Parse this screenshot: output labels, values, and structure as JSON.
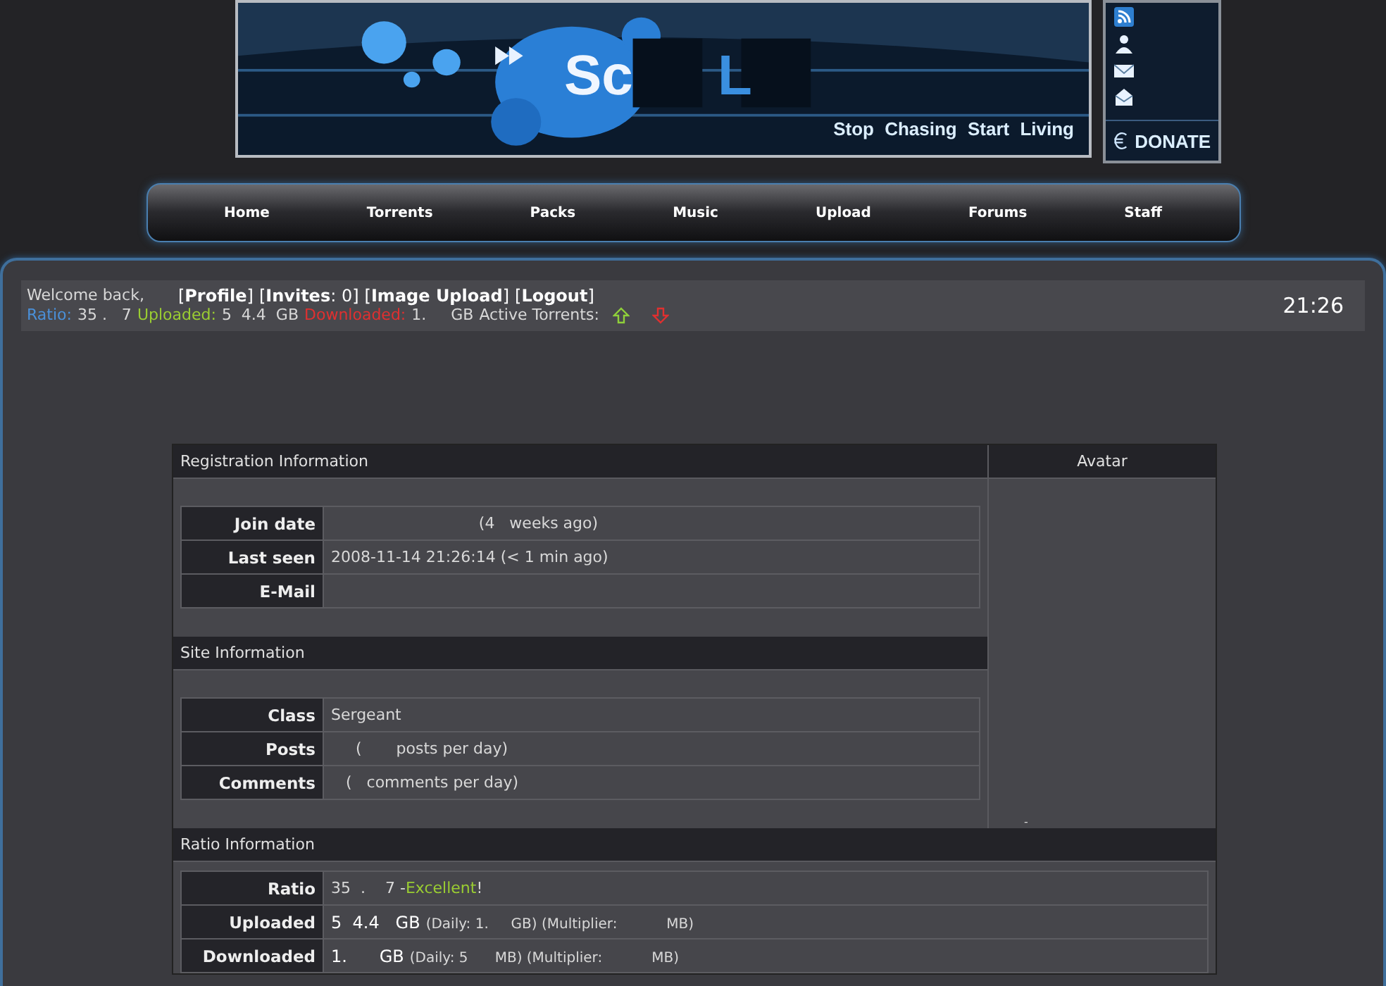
{
  "header": {
    "logo_parts": [
      "Sc",
      "L"
    ],
    "tagline": "Stop Chasing Start Living",
    "donate": "DONATE"
  },
  "nav": [
    {
      "label": "Home"
    },
    {
      "label": "Torrents"
    },
    {
      "label": "Packs"
    },
    {
      "label": "Music"
    },
    {
      "label": "Upload"
    },
    {
      "label": "Forums"
    },
    {
      "label": "Staff"
    }
  ],
  "userbar": {
    "welcome": "Welcome back,",
    "links": [
      "[**Profile**]",
      "[**Invites**: 0]",
      "[**Image Upload**]",
      "[**Logout**]"
    ],
    "stats": [
      {
        "label": "Ratio:",
        "value": "35 .   7",
        "color": "#4a90d9"
      },
      {
        "label": "Uploaded:",
        "value": "5  4.4  GB",
        "color": "#9acd32"
      },
      {
        "label": "Downloaded:",
        "value": "1.     GB",
        "color": "#e03030"
      }
    ],
    "active_label": "Active Torrents:",
    "clock": "21:26"
  },
  "profile": {
    "avatar_heading": "Avatar",
    "avatar_mark": "-",
    "sections": [
      {
        "title": "Registration Information",
        "rows": [
          {
            "label": "Join date",
            "parts": [
              {
                "kind": "plain",
                "text": "                              (4   weeks ago)"
              }
            ]
          },
          {
            "label": "Last seen",
            "parts": [
              {
                "kind": "plain",
                "text": "2008-11-14 21:26:14 (< 1 min ago)"
              }
            ]
          },
          {
            "label": "E-Mail",
            "parts": []
          }
        ]
      },
      {
        "title": "Site Information",
        "rows": [
          {
            "label": "Class",
            "parts": [
              {
                "kind": "plain",
                "text": "Sergeant"
              }
            ]
          },
          {
            "label": "Posts",
            "parts": [
              {
                "kind": "plain",
                "text": "     (       posts per day)"
              }
            ]
          },
          {
            "label": "Comments",
            "parts": [
              {
                "kind": "plain",
                "text": "   (   comments per day)"
              }
            ]
          }
        ]
      },
      {
        "title": "Ratio Information",
        "wide": true,
        "rows": [
          {
            "label": "Ratio",
            "parts": [
              {
                "kind": "plain",
                "text": "35  .    7 -"
              },
              {
                "kind": "good",
                "text": "Excellent"
              },
              {
                "kind": "plain",
                "text": "!"
              }
            ]
          },
          {
            "label": "Uploaded",
            "parts": [
              {
                "kind": "main",
                "text": "5  4.4   GB"
              },
              {
                "kind": "note",
                "text": "(Daily: 1.     GB) (Multiplier:           MB)"
              }
            ]
          },
          {
            "label": "Downloaded",
            "parts": [
              {
                "kind": "main",
                "text": "1.      GB"
              },
              {
                "kind": "note",
                "text": "(Daily: 5      MB) (Multiplier:           MB)"
              }
            ]
          }
        ]
      }
    ]
  }
}
